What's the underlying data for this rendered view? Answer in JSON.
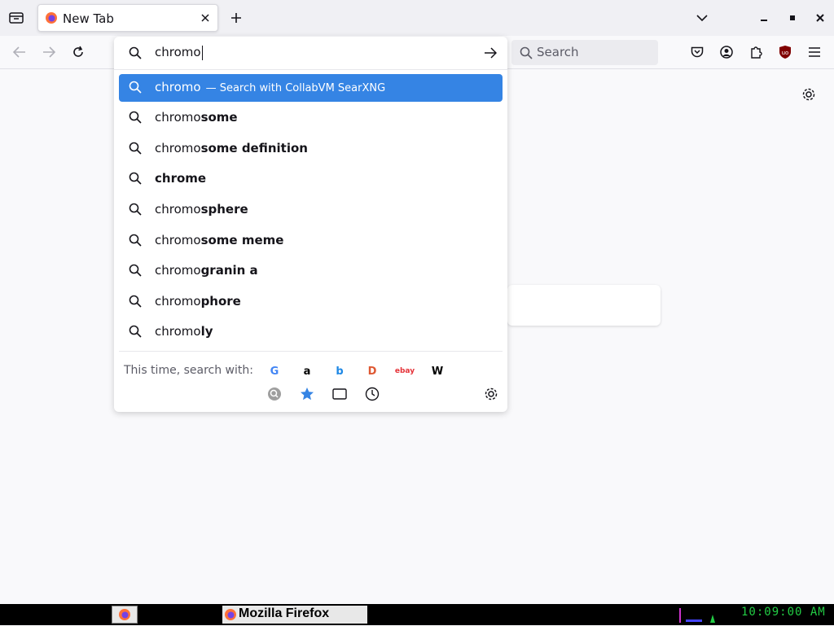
{
  "browser": {
    "tab": {
      "title": "New Tab"
    },
    "search": {
      "placeholder": "Search"
    }
  },
  "urlbar": {
    "typed": "chromo",
    "selected": {
      "text": "chromo",
      "action": "— Search with CollabVM SearXNG"
    },
    "suggestions": [
      {
        "prefix": "chromo",
        "rest": "some"
      },
      {
        "prefix": "chromo",
        "rest": "some definition"
      },
      {
        "prefix": "",
        "rest": "chrome"
      },
      {
        "prefix": "chromo",
        "rest": "sphere"
      },
      {
        "prefix": "chromo",
        "rest": "some meme"
      },
      {
        "prefix": "chromo",
        "rest": "granin a"
      },
      {
        "prefix": "chromo",
        "rest": "phore"
      },
      {
        "prefix": "chromo",
        "rest": "ly"
      }
    ],
    "oneoff": {
      "label": "This time, search with:",
      "engines": [
        {
          "name": "google-icon",
          "glyph": "G",
          "color": "#4285f4"
        },
        {
          "name": "amazon-icon",
          "glyph": "a",
          "color": "#000000"
        },
        {
          "name": "bing-icon",
          "glyph": "b",
          "color": "#1e88e5"
        },
        {
          "name": "duckduckgo-icon",
          "glyph": "D",
          "color": "#de5833"
        },
        {
          "name": "ebay-icon",
          "glyph": "ebay",
          "color": "#e53238"
        },
        {
          "name": "wikipedia-icon",
          "glyph": "W",
          "color": "#000000"
        }
      ]
    }
  },
  "taskbar": {
    "window_title": "Mozilla Firefox",
    "clock": "10:09:00 AM"
  },
  "colors": {
    "accent": "#3584e4",
    "taskbar": "#000000",
    "clock": "#22cc44"
  }
}
